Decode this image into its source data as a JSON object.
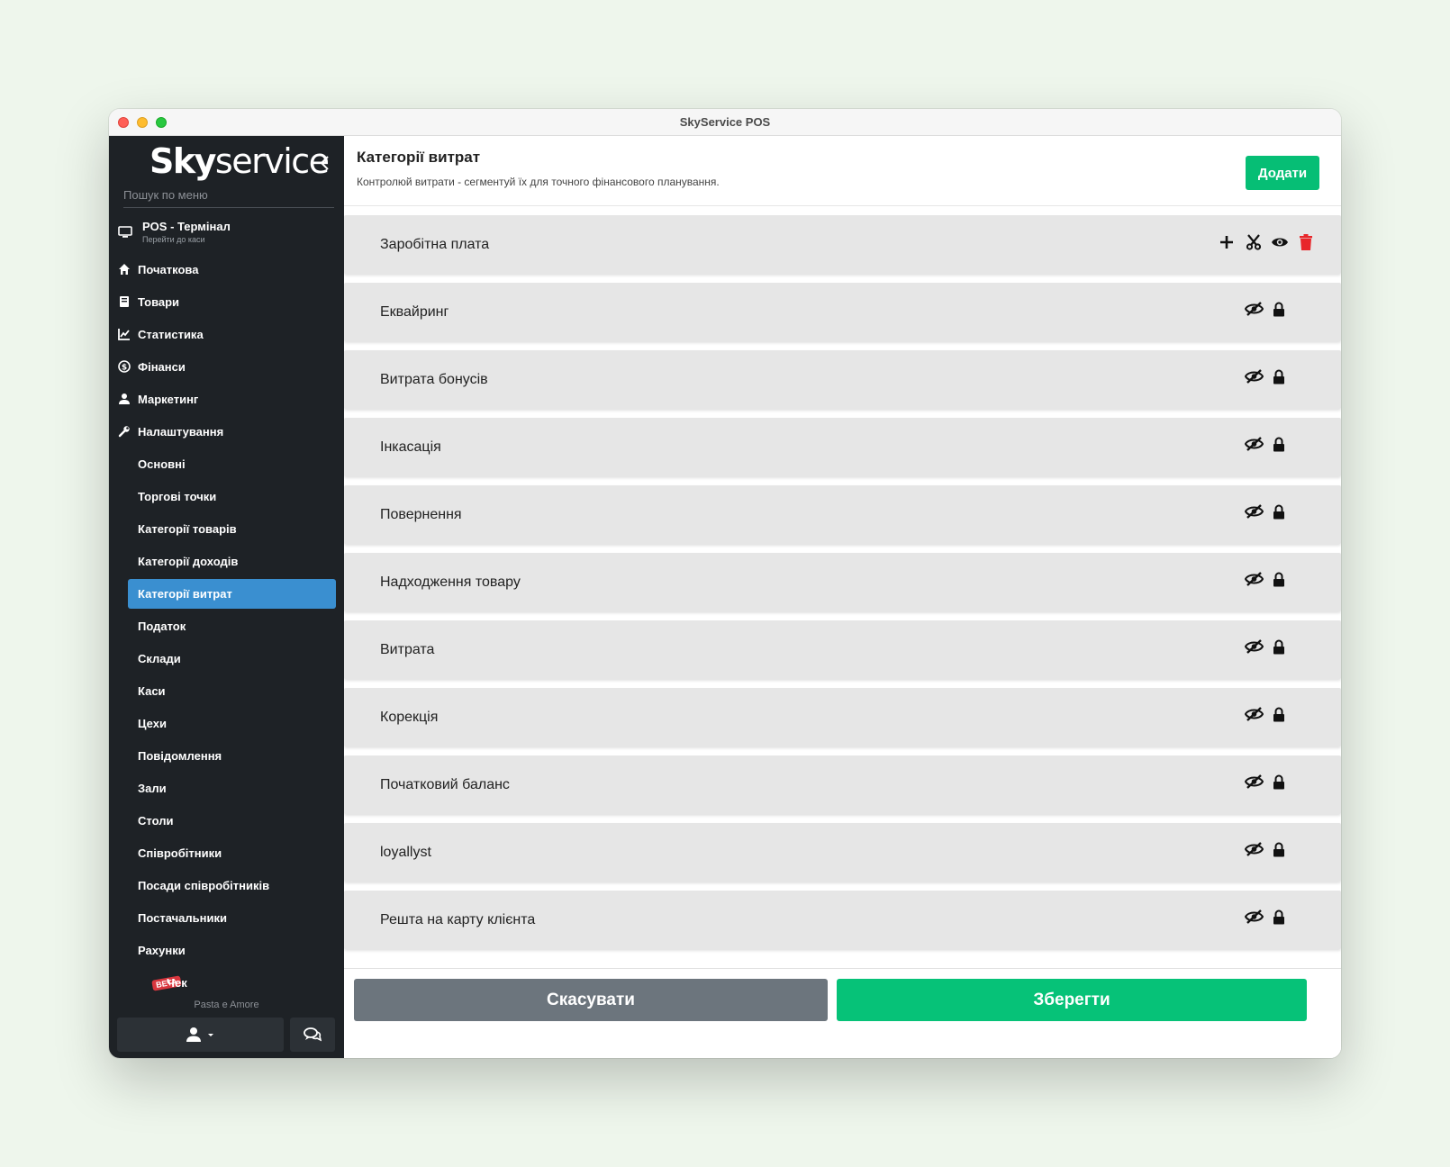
{
  "window": {
    "title": "SkyService POS"
  },
  "sidebar": {
    "logo_bold": "Sky",
    "logo_light": "service",
    "search_placeholder": "Пошук по меню",
    "pos": {
      "label": "POS - Термінал",
      "sublabel": "Перейти до каси"
    },
    "items": [
      {
        "label": "Початкова",
        "icon": "home-icon"
      },
      {
        "label": "Товари",
        "icon": "book-icon"
      },
      {
        "label": "Статистика",
        "icon": "chart-icon"
      },
      {
        "label": "Фінанси",
        "icon": "dollar-icon"
      },
      {
        "label": "Маркетинг",
        "icon": "user-tie-icon"
      },
      {
        "label": "Налаштування",
        "icon": "wrench-icon"
      }
    ],
    "settings_items": [
      "Основні",
      "Торгові точки",
      "Категорії товарів",
      "Категорії доходів",
      "Категорії витрат",
      "Податок",
      "Склади",
      "Каси",
      "Цехи",
      "Повідомлення",
      "Зали",
      "Столи",
      "Співробітники",
      "Посади співробітників",
      "Постачальники",
      "Рахунки",
      "Чек"
    ],
    "active_item": "Категорії витрат",
    "beta_label": "BETA",
    "shop_name": "Pasta e Amore"
  },
  "header": {
    "title": "Категорії витрат",
    "subtitle": "Контролюй витрати - сегментуй їх для точного фінансового планування.",
    "add_label": "Додати"
  },
  "categories": [
    {
      "name": "Заробітна плата",
      "editable": true
    },
    {
      "name": "Еквайринг",
      "editable": false
    },
    {
      "name": "Витрата бонусів",
      "editable": false
    },
    {
      "name": "Інкасація",
      "editable": false
    },
    {
      "name": "Повернення",
      "editable": false
    },
    {
      "name": "Надходження товару",
      "editable": false
    },
    {
      "name": "Витрата",
      "editable": false
    },
    {
      "name": "Корекція",
      "editable": false
    },
    {
      "name": "Початковий баланс",
      "editable": false
    },
    {
      "name": "loyallyst",
      "editable": false
    },
    {
      "name": "Решта на карту клієнта",
      "editable": false
    }
  ],
  "footer": {
    "cancel_label": "Скасувати",
    "save_label": "Зберегти"
  },
  "colors": {
    "accent_green": "#06c278",
    "active_blue": "#3a8fd0",
    "delete_red": "#e8262a",
    "sidebar_bg": "#1e2226"
  }
}
